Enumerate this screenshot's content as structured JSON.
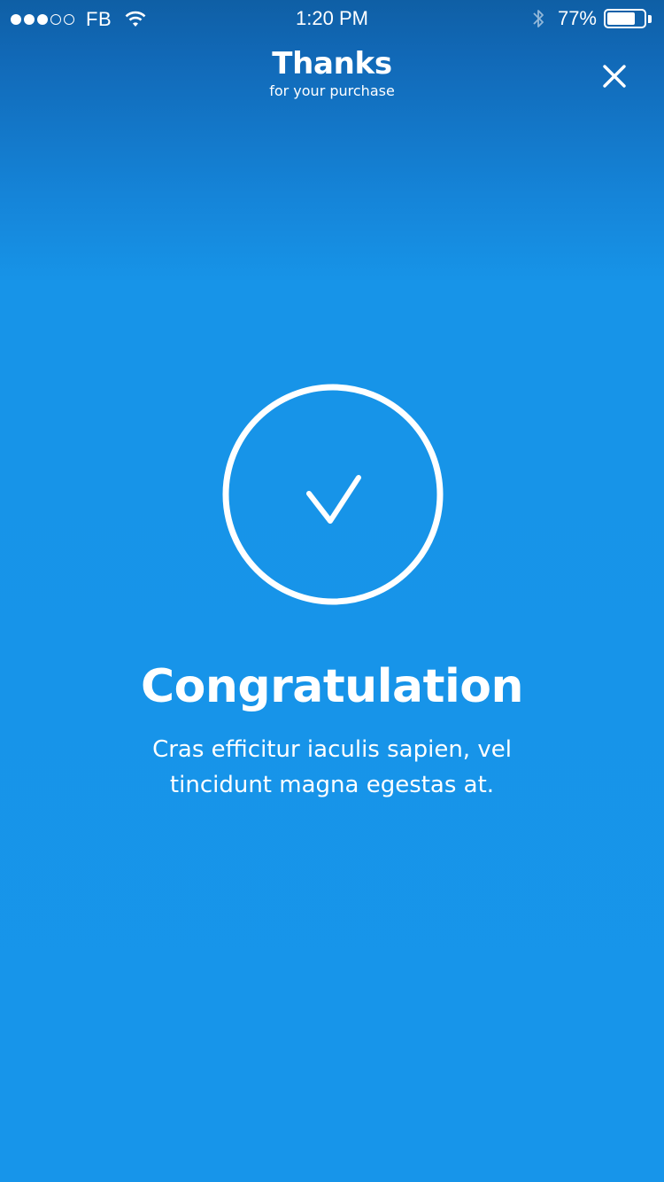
{
  "status_bar": {
    "carrier": "FB",
    "time": "1:20 PM",
    "battery_percent": "77%",
    "battery_level": 0.77,
    "signal_bars_filled": 3,
    "signal_bars_total": 5
  },
  "header": {
    "title": "Thanks",
    "subtitle": "for your purchase",
    "close_icon": "close-icon"
  },
  "success": {
    "icon": "checkmark-circle-icon",
    "heading": "Congratulation",
    "message": "Cras efficitur iaculis sapien, vel tincidunt magna egestas at."
  },
  "colors": {
    "background_top": "#0f5fa5",
    "background": "#1795ea",
    "foreground": "#ffffff"
  }
}
